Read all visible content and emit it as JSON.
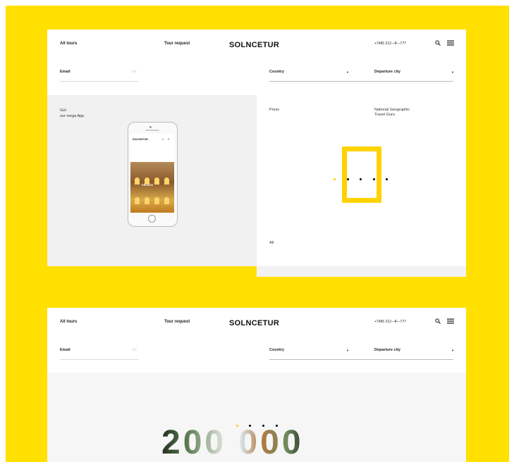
{
  "brand": {
    "accent": "#ffe000",
    "ng_yellow": "#ffd200"
  },
  "header": {
    "all_tours": "All tours",
    "tour_request": "Tour request",
    "logo": "SOLNCETUR",
    "phone": "+7495 212—8—777",
    "icons": [
      "search-icon",
      "menu-icon"
    ]
  },
  "form": {
    "email_label": "Email",
    "email_placeholder": "On",
    "country_label": "Country",
    "departure_label": "Departure city"
  },
  "app_promo": {
    "line1": "Get",
    "line2": "our mega App",
    "mobile_logo": "SOLNCETUR",
    "mobile_hero": "PALACE"
  },
  "ng_section": {
    "press": "Press",
    "title_line1": "National Geographic",
    "title_line2": "Travel Guru",
    "all": "All"
  },
  "second": {
    "big_number": "200 000"
  },
  "carousel": {
    "count": 5,
    "active": 0
  }
}
